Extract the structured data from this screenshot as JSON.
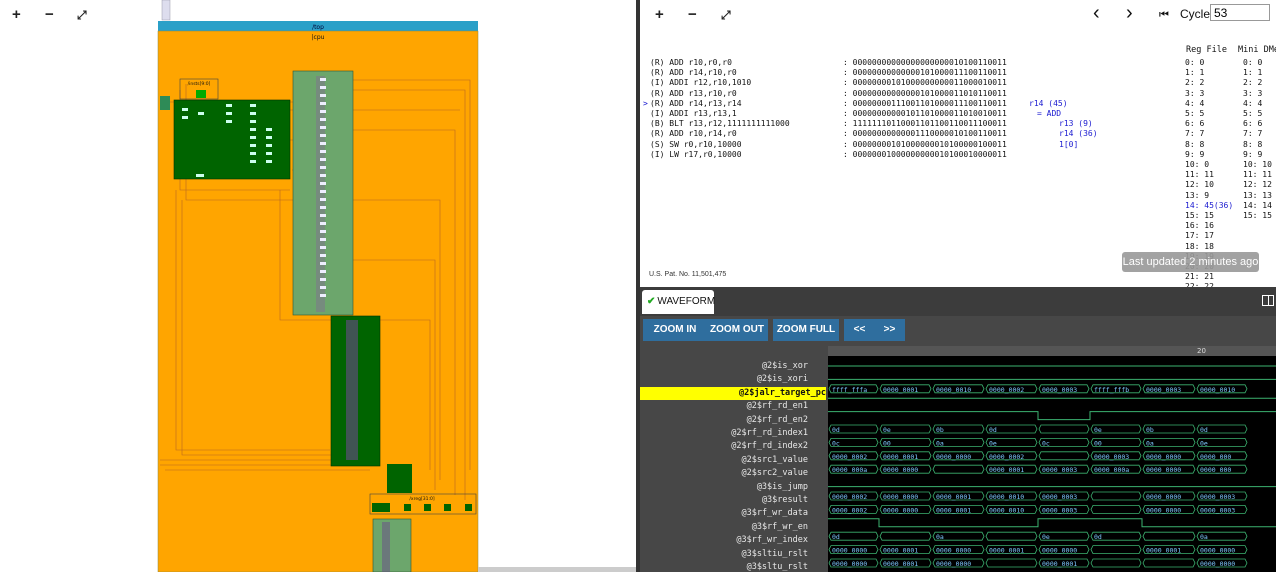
{
  "left_toolbar": {
    "zoom_in": "+",
    "zoom_out": "−",
    "fit": "⤢"
  },
  "diagram": {
    "top_label": "/top",
    "cpu_label": "|cpu",
    "insts_label": "/insts[9:0]",
    "xreg_label": "/xreg[31:0]"
  },
  "right_toolbar": {
    "zoom_in": "+",
    "zoom_out": "−",
    "fit": "⤢",
    "prev": "‹",
    "next": "›",
    "first": "⏮"
  },
  "cycle": {
    "label": "Cycle:",
    "value": "53"
  },
  "instructions": [
    {
      "marker": " ",
      "asm": "(R) ADD r10,r0,r0",
      "bin": ": 00000000000000000000010100110011",
      "note": ""
    },
    {
      "marker": " ",
      "asm": "(R) ADD r14,r10,r0",
      "bin": ": 00000000000000101000011100110011",
      "note": ""
    },
    {
      "marker": " ",
      "asm": "(I) ADDI r12,r10,1010",
      "bin": ": 00000000101000000000011000010011",
      "note": ""
    },
    {
      "marker": " ",
      "asm": "(R) ADD r13,r10,r0",
      "bin": ": 00000000000000101000011010110011",
      "note": ""
    },
    {
      "marker": ">",
      "asm": "(R) ADD r14,r13,r14",
      "bin": ": 00000000111001101000011100110011",
      "note": "r14 (45)"
    },
    {
      "marker": " ",
      "asm": "(I) ADDI r13,r13,1",
      "bin": ": 00000000000101101000011010010011",
      "note": "= ADD"
    },
    {
      "marker": " ",
      "asm": "(B) BLT r13,r12,1111111111000",
      "bin": ": 11111110110001101100110011100011",
      "note": "r13 (9)"
    },
    {
      "marker": " ",
      "asm": "(R) ADD r10,r14,r0",
      "bin": ": 00000000000001110000010100110011",
      "note": "r14 (36)"
    },
    {
      "marker": " ",
      "asm": "(S) SW r0,r10,10000",
      "bin": ": 00000000101000000010100000100011",
      "note": "1[0]"
    },
    {
      "marker": " ",
      "asm": "(I) LW r17,r0,10000",
      "bin": ": 00000001000000000010100010000011",
      "note": ""
    }
  ],
  "reg_file": {
    "header": "Reg File",
    "rows": [
      "0: 0",
      "1: 1",
      "2: 2",
      "3: 3",
      "4: 4",
      "5: 5",
      "6: 6",
      "7: 7",
      "8: 8",
      "9: 9",
      "10: 0",
      "11: 11",
      "12: 10",
      "13: 9",
      "14: 45(36)",
      "15: 15",
      "16: 16",
      "17: 17",
      "18: 18",
      "19: 19",
      "20: 20",
      "21: 21",
      "22: 22"
    ]
  },
  "dmem": {
    "header": "Mini DMem",
    "rows": [
      "0: 0",
      "1: 1",
      "2: 2",
      "3: 3",
      "4: 4",
      "5: 5",
      "6: 6",
      "7: 7",
      "8: 8",
      "9: 9",
      "10: 10",
      "11: 11",
      "12: 12",
      "13: 13",
      "14: 14",
      "15: 15"
    ]
  },
  "patent": "U.S. Pat. No. 11,501,475",
  "last_updated": "Last updated 2 minutes ago",
  "waveform": {
    "tab_label": "WAVEFORM",
    "buttons": {
      "zoom_in": "ZOOM IN",
      "zoom_out": "ZOOM OUT",
      "zoom_full": "ZOOM FULL",
      "back": "<<",
      "fwd": ">>"
    },
    "ruler_mark": "20",
    "signals": [
      {
        "name": "@2$is_xor",
        "highlight": false
      },
      {
        "name": "@2$is_xori",
        "highlight": false
      },
      {
        "name": "@2$jalr_target_pc",
        "highlight": true
      },
      {
        "name": "@2$rf_rd_en1",
        "highlight": false
      },
      {
        "name": "@2$rf_rd_en2",
        "highlight": false
      },
      {
        "name": "@2$rf_rd_index1",
        "highlight": false
      },
      {
        "name": "@2$rf_rd_index2",
        "highlight": false
      },
      {
        "name": "@2$src1_value",
        "highlight": false
      },
      {
        "name": "@2$src2_value",
        "highlight": false
      },
      {
        "name": "@3$is_jump",
        "highlight": false
      },
      {
        "name": "@3$result",
        "highlight": false
      },
      {
        "name": "@3$rf_wr_data",
        "highlight": false
      },
      {
        "name": "@3$rf_wr_en",
        "highlight": false
      },
      {
        "name": "@3$rf_wr_index",
        "highlight": false
      },
      {
        "name": "@3$sltiu_rslt",
        "highlight": false
      },
      {
        "name": "@3$sltu_rslt",
        "highlight": false
      }
    ],
    "bus_values": [
      [
        "",
        "",
        "",
        "",
        "",
        "",
        "",
        ""
      ],
      [
        "",
        "",
        "",
        "",
        "",
        "",
        "",
        ""
      ],
      [
        "ffff_fffa",
        "0000_0001",
        "0000_0010",
        "0000_0002",
        "0000_0003",
        "ffff_fffb",
        "0000_0003",
        "0000_0010"
      ],
      [
        "",
        "",
        "",
        "",
        "",
        "",
        "",
        ""
      ],
      [
        "",
        "",
        "",
        "",
        "",
        "",
        "",
        ""
      ],
      [
        "0d",
        "0e",
        "0b",
        "0d",
        "",
        "0e",
        "0b",
        "0d"
      ],
      [
        "0c",
        "00",
        "0a",
        "0e",
        "0c",
        "00",
        "0a",
        "0e"
      ],
      [
        "0000_0002",
        "0000_0001",
        "0000_0000",
        "0000_0002",
        "",
        "0000_0003",
        "0000_0000",
        "0000_000"
      ],
      [
        "0000_000a",
        "0000_0000",
        "",
        "0000_0001",
        "0000_0003",
        "0000_000a",
        "0000_0000",
        "0000_000"
      ],
      [
        "",
        "",
        "",
        "",
        "",
        "",
        "",
        ""
      ],
      [
        "0000_0002",
        "0000_0000",
        "0000_0001",
        "0000_0010",
        "0000_0003",
        "",
        "0000_0000",
        "0000_0003"
      ],
      [
        "0000_0002",
        "0000_0000",
        "0000_0001",
        "0000_0010",
        "0000_0003",
        "",
        "0000_0000",
        "0000_0003"
      ],
      [
        "",
        "",
        "",
        "",
        "",
        "",
        "",
        ""
      ],
      [
        "0d",
        "",
        "0a",
        "",
        "0e",
        "0d",
        "",
        "0a"
      ],
      [
        "0000_0000",
        "0000_0001",
        "0000_0000",
        "0000_0001",
        "0000_0000",
        "",
        "0000_0001",
        "0000_0000"
      ],
      [
        "0000_0000",
        "0000_0001",
        "0000_0000",
        "",
        "0000_0001",
        "",
        "",
        "0000_0000"
      ]
    ]
  }
}
